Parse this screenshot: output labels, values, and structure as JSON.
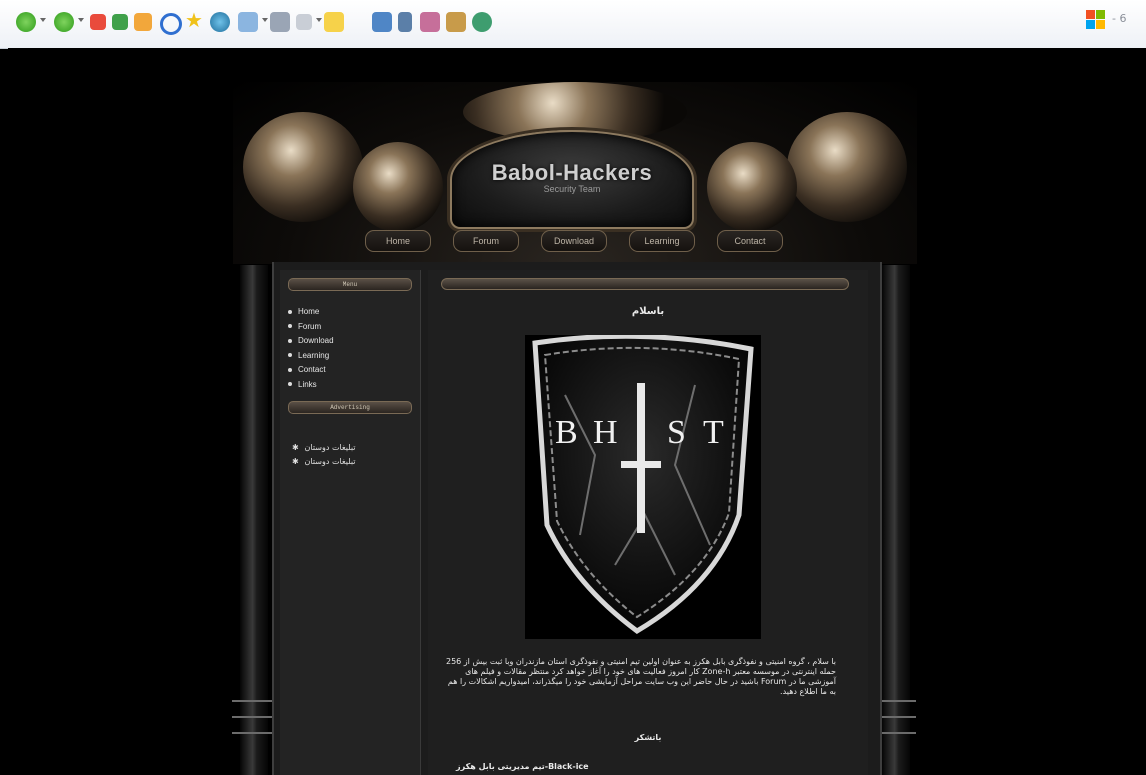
{
  "browser": {
    "toolbar_icons": [
      "back-icon",
      "forward-icon",
      "stop-icon",
      "refresh-icon",
      "home-icon",
      "search-icon",
      "favorites-icon",
      "history-icon",
      "mail-icon",
      "print-icon",
      "edit-icon",
      "notes-icon",
      "messenger-icon",
      "tools-icon",
      "research-icon",
      "media-icon",
      "chat-icon"
    ],
    "window_controls": "- 6"
  },
  "site": {
    "title": "Babol-Hackers",
    "subtitle": "Security Team",
    "nav": [
      "Home",
      "Forum",
      "Download",
      "Learning",
      "Contact"
    ]
  },
  "sidebar": {
    "menu_header": "Menu",
    "menu_items": [
      "Home",
      "Forum",
      "Download",
      "Learning",
      "Contact",
      "Links"
    ],
    "ads_header": "Advertising",
    "ad_items": [
      "تبلیغات دوستان",
      "تبلیغات دوستان"
    ]
  },
  "content": {
    "greeting": "باسلام",
    "logo_letters": [
      "B",
      "H",
      "S",
      "T"
    ],
    "intro": "با سلام ، گروه امنیتی و نفوذگری بابل هکرز به عنوان اولین تیم امنیتی و نفوذگری استان مازندران وبا ثبت بیش از 256 حمله اینترنتی در موسسه معتبر Zone-h کار امروز فعالیت های خود را آغاز خواهد کرد منتظر مقالات و فیلم های آموزشی ما در Forum باشید در حال حاضر این وب سایت مراحل آزمایشی خود را میگذراند، امیدواریم اشکالات را هم به ما اطلاع دهید.",
    "thanks": "باتشکر",
    "team": "تیم مدیریتی بابل هکرز-Black-ice"
  },
  "colors": {
    "background": "#000000",
    "panel": "#1c1c1c",
    "ornament": "#8a7458",
    "text": "#e6e6e6"
  }
}
